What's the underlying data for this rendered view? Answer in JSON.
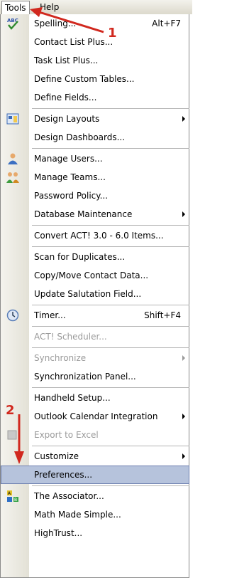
{
  "menubar": {
    "tools": "Tools",
    "help": "Help"
  },
  "menu": {
    "items": [
      {
        "label": "Spelling...",
        "shortcut": "Alt+F7"
      },
      {
        "label": "Contact List Plus..."
      },
      {
        "label": "Task List Plus..."
      },
      {
        "label": "Define Custom Tables..."
      },
      {
        "label": "Define Fields..."
      },
      {
        "label": "Design Layouts"
      },
      {
        "label": "Design Dashboards..."
      },
      {
        "label": "Manage Users..."
      },
      {
        "label": "Manage Teams..."
      },
      {
        "label": "Password Policy..."
      },
      {
        "label": "Database Maintenance"
      },
      {
        "label": "Convert ACT! 3.0 - 6.0 Items..."
      },
      {
        "label": "Scan for Duplicates..."
      },
      {
        "label": "Copy/Move Contact Data..."
      },
      {
        "label": "Update Salutation Field..."
      },
      {
        "label": "Timer...",
        "shortcut": "Shift+F4"
      },
      {
        "label": "ACT! Scheduler..."
      },
      {
        "label": "Synchronize"
      },
      {
        "label": "Synchronization Panel..."
      },
      {
        "label": "Handheld Setup..."
      },
      {
        "label": "Outlook Calendar Integration"
      },
      {
        "label": "Export to Excel"
      },
      {
        "label": "Customize"
      },
      {
        "label": "Preferences..."
      },
      {
        "label": "The Associator..."
      },
      {
        "label": "Math Made Simple..."
      },
      {
        "label": "HighTrust..."
      }
    ]
  },
  "annotations": {
    "one": "1",
    "two": "2"
  },
  "colors": {
    "annotation": "#d1281e",
    "highlight": "#b6c3dc"
  }
}
